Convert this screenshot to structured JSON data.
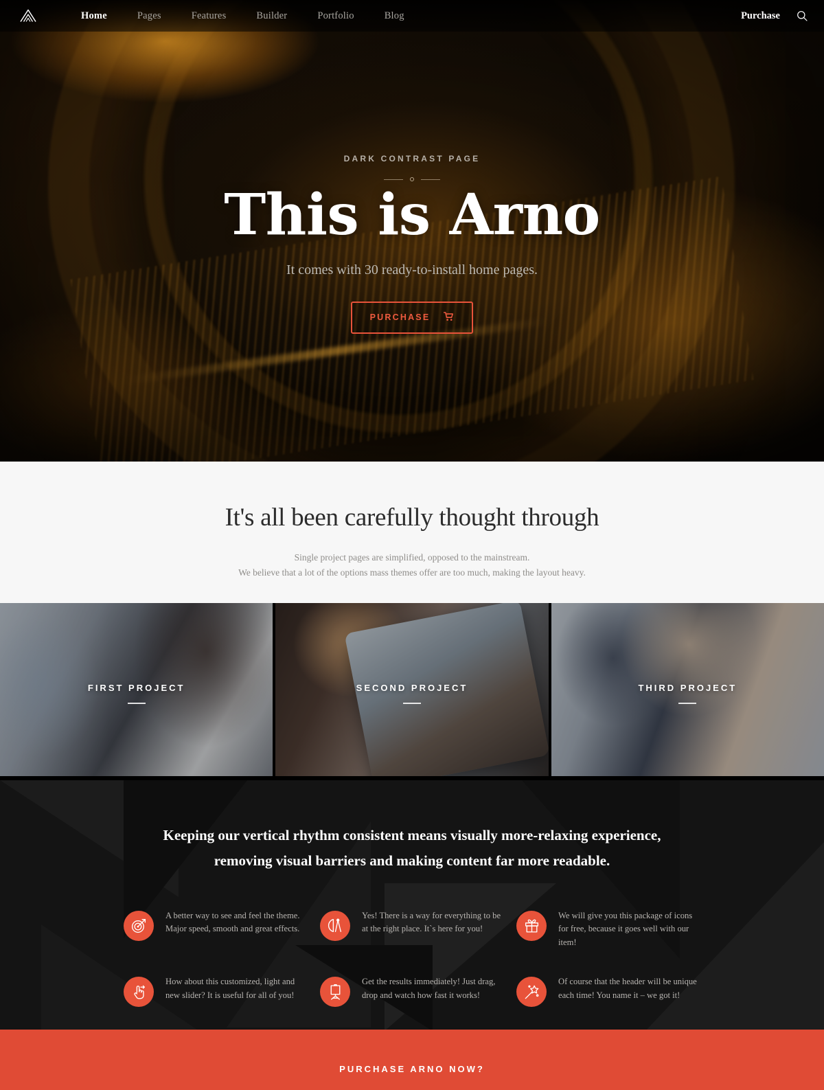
{
  "theme": {
    "accent": "#e8533a",
    "cta_bg": "#e04b35",
    "dark_bg": "#141414",
    "light_bg": "#f7f7f7"
  },
  "navbar": {
    "logo_icon": "mountain-chevron-logo",
    "links": [
      {
        "label": "Home",
        "active": true
      },
      {
        "label": "Pages",
        "active": false
      },
      {
        "label": "Features",
        "active": false
      },
      {
        "label": "Builder",
        "active": false
      },
      {
        "label": "Portfolio",
        "active": false
      },
      {
        "label": "Blog",
        "active": false
      }
    ],
    "purchase_label": "Purchase",
    "search_icon": "search-icon"
  },
  "hero": {
    "eyebrow": "DARK CONTRAST PAGE",
    "title": "This is Arno",
    "subtitle": "It comes with 30 ready-to-install home pages.",
    "button_label": "PURCHASE",
    "button_icon": "shopping-cart-icon"
  },
  "lead": {
    "title": "It's all been carefully thought through",
    "line1": "Single project pages are simplified, opposed to the mainstream.",
    "line2": "We believe that a lot of the options mass themes offer are too much, making the layout heavy."
  },
  "gallery": {
    "items": [
      {
        "label": "FIRST PROJECT"
      },
      {
        "label": "SECOND PROJECT"
      },
      {
        "label": "THIRD PROJECT"
      }
    ]
  },
  "dark": {
    "heading_line1": "Keeping our vertical rhythm consistent means visually more-relaxing experience,",
    "heading_line2": "removing visual barriers and making content far more readable.",
    "features": [
      {
        "icon": "target-arrow-icon",
        "text": "A better way to see and feel the theme. Major speed, smooth and great effects."
      },
      {
        "icon": "compass-divider-icon",
        "text": "Yes! There is a way for everything to be at the right place. It`s here for you!"
      },
      {
        "icon": "gift-box-icon",
        "text": "We will give you this package of icons for free, because it goes well with our item!"
      },
      {
        "icon": "swipe-hand-icon",
        "text": "How about this customized, light and new slider? It is useful for all of you!"
      },
      {
        "icon": "easel-board-icon",
        "text": "Get the results immediately! Just drag, drop and watch how fast it works!"
      },
      {
        "icon": "magic-wand-icon",
        "text": "Of course that the header will be unique each time! You name it – we got it!"
      }
    ]
  },
  "cta": {
    "text": "PURCHASE ARNO NOW?"
  }
}
